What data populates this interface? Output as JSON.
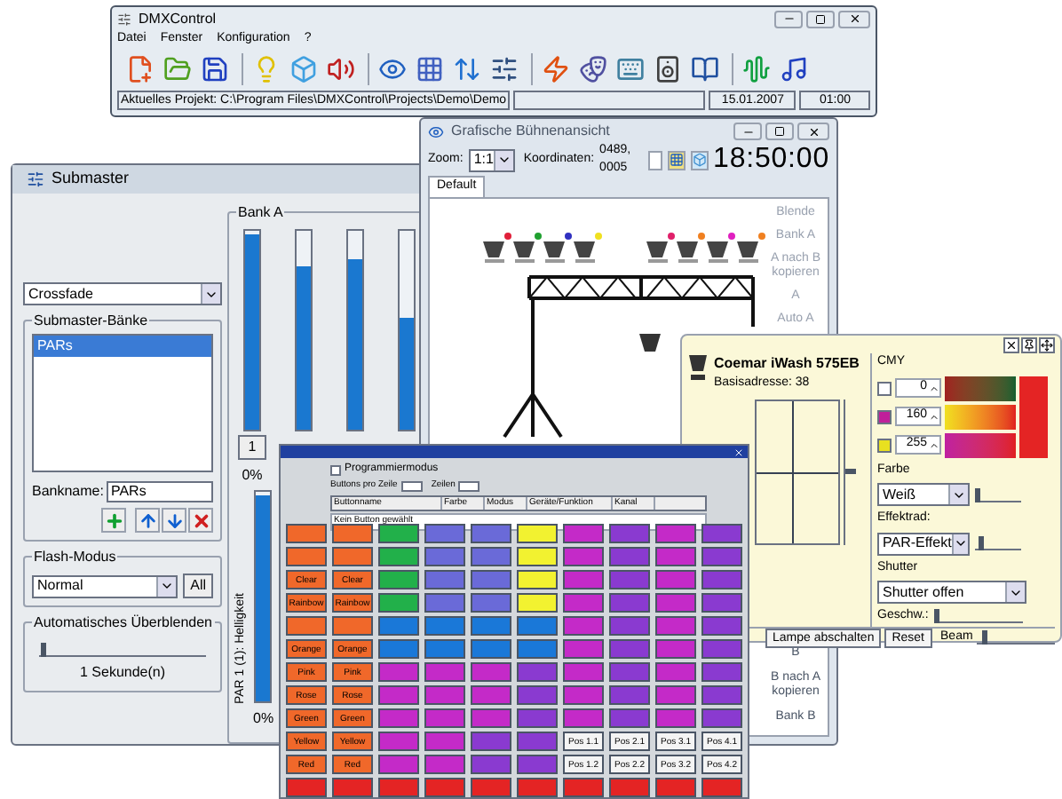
{
  "main_window": {
    "title": "DMXControl",
    "menu": [
      "Datei",
      "Fenster",
      "Konfiguration",
      "?"
    ],
    "status": {
      "project": "Aktuelles Projekt: C:\\Program Files\\DMXControl\\Projects\\Demo\\Demo",
      "date": "15.01.2007",
      "time": "01:00"
    }
  },
  "submaster": {
    "title": "Submaster",
    "mode": "Crossfade",
    "banks_label": "Submaster-Bänke",
    "banks": [
      {
        "label": "PARs",
        "selected": true
      }
    ],
    "bankname_label": "Bankname:",
    "bankname": "PARs",
    "flash_label": "Flash-Modus",
    "flash_mode": "Normal",
    "all_button": "All",
    "auto_label": "Automatisches Überblenden",
    "auto_slider": {
      "level": 0.02
    },
    "auto_reading": "1 Sekunde(n)",
    "bank_a_label": "Bank A",
    "faders": [
      {
        "level": 0.98
      },
      {
        "level": 0.82
      },
      {
        "level": 0.86
      },
      {
        "level": 0.56
      }
    ],
    "fader_button": "1",
    "fader_reading": "0%",
    "lower_fader": {
      "level": 0.98,
      "reading": "0%",
      "caption": "PAR 1 (1): Helligkeit"
    },
    "side_top": [
      "Blende",
      "Bank A",
      "A nach B kopieren",
      "A",
      "Auto A"
    ],
    "side_bottom": [
      "B",
      "B nach A kopieren",
      "Bank B"
    ]
  },
  "stage": {
    "title": "Grafische Bühnenansicht",
    "zoom_label": "Zoom:",
    "zoom": "1:1",
    "coords_label": "Koordinaten:",
    "coords": "0489, 0005",
    "clock": "18:50:00",
    "tabs": [
      {
        "label": "Default",
        "selected": true
      }
    ],
    "fixtures": [
      {
        "color": "#e0203a"
      },
      {
        "color": "#20a030"
      },
      {
        "color": "#3030c0"
      },
      {
        "color": "#f0e020"
      },
      {
        "color": "#e0206a"
      },
      {
        "color": "#f08020"
      },
      {
        "color": "#e020c0"
      },
      {
        "color": "#f08020"
      }
    ]
  },
  "device": {
    "name": "Coemar iWash 575EB",
    "address": "Basisadresse: 38",
    "pan_tilt": {
      "level": 0.5
    },
    "cmy_label": "CMY",
    "cmy": [
      {
        "value": "0",
        "color": "#ffffff"
      },
      {
        "value": "160",
        "color": "#c0209a"
      },
      {
        "value": "255",
        "color": "#e8e020"
      }
    ],
    "color_label": "Farbe",
    "color_value": "Weiß",
    "color_slider": {
      "level": 0.05
    },
    "effect_label": "Effektrad:",
    "effect_value": "PAR-Effekt",
    "effect_slider": {
      "level": 0.1
    },
    "shutter_label": "Shutter",
    "shutter_value": "Shutter offen",
    "speed_label": "Geschw.:",
    "speed_slider": {
      "level": 0.02
    },
    "actions": [
      "Lampe abschalten",
      "Reset"
    ],
    "beam_label": "Beam",
    "beam_slider": {
      "level": 0.1
    }
  },
  "buttons_window": {
    "program_mode": {
      "label": "Programmiermodus",
      "checked": false
    },
    "per_row_label": "Buttons pro Zeile",
    "rows_label": "Zeilen",
    "columns": [
      "Buttonname",
      "Farbe",
      "Modus",
      "Geräte/Funktion",
      "Kanal"
    ],
    "selection": "Kein Button gewählt",
    "grid": [
      [
        {
          "color": "#f0682a"
        },
        {
          "color": "#f0682a"
        },
        {
          "color": "#22b04a"
        },
        {
          "color": "#6a6ad8"
        },
        {
          "color": "#6a6ad8"
        },
        {
          "color": "#f2f230"
        },
        {
          "color": "#c42ac8"
        },
        {
          "color": "#8a3ad0"
        },
        {
          "color": "#c42ac8"
        },
        {
          "color": "#8a3ad0"
        }
      ],
      [
        {
          "color": "#f0682a"
        },
        {
          "color": "#f0682a"
        },
        {
          "color": "#22b04a"
        },
        {
          "color": "#6a6ad8"
        },
        {
          "color": "#6a6ad8"
        },
        {
          "color": "#f2f230"
        },
        {
          "color": "#c42ac8"
        },
        {
          "color": "#8a3ad0"
        },
        {
          "color": "#c42ac8"
        },
        {
          "color": "#8a3ad0"
        }
      ],
      [
        {
          "color": "#f0682a",
          "label": "Clear"
        },
        {
          "color": "#f0682a",
          "label": "Clear"
        },
        {
          "color": "#22b04a"
        },
        {
          "color": "#6a6ad8"
        },
        {
          "color": "#6a6ad8"
        },
        {
          "color": "#f2f230"
        },
        {
          "color": "#c42ac8"
        },
        {
          "color": "#8a3ad0"
        },
        {
          "color": "#c42ac8"
        },
        {
          "color": "#8a3ad0"
        }
      ],
      [
        {
          "color": "#f0682a",
          "label": "Rainbow"
        },
        {
          "color": "#f0682a",
          "label": "Rainbow"
        },
        {
          "color": "#22b04a"
        },
        {
          "color": "#6a6ad8"
        },
        {
          "color": "#6a6ad8"
        },
        {
          "color": "#f2f230"
        },
        {
          "color": "#c42ac8"
        },
        {
          "color": "#8a3ad0"
        },
        {
          "color": "#c42ac8"
        },
        {
          "color": "#8a3ad0"
        }
      ],
      [
        {
          "color": "#f0682a"
        },
        {
          "color": "#f0682a"
        },
        {
          "color": "#1a78d8"
        },
        {
          "color": "#1a78d8"
        },
        {
          "color": "#1a78d8"
        },
        {
          "color": "#1a78d8"
        },
        {
          "color": "#c42ac8"
        },
        {
          "color": "#8a3ad0"
        },
        {
          "color": "#c42ac8"
        },
        {
          "color": "#8a3ad0"
        }
      ],
      [
        {
          "color": "#f0682a",
          "label": "Orange"
        },
        {
          "color": "#f0682a",
          "label": "Orange"
        },
        {
          "color": "#1a78d8"
        },
        {
          "color": "#1a78d8"
        },
        {
          "color": "#1a78d8"
        },
        {
          "color": "#1a78d8"
        },
        {
          "color": "#c42ac8"
        },
        {
          "color": "#8a3ad0"
        },
        {
          "color": "#c42ac8"
        },
        {
          "color": "#8a3ad0"
        }
      ],
      [
        {
          "color": "#f0682a",
          "label": "Pink"
        },
        {
          "color": "#f0682a",
          "label": "Pink"
        },
        {
          "color": "#c42ac8"
        },
        {
          "color": "#c42ac8"
        },
        {
          "color": "#c42ac8"
        },
        {
          "color": "#8a3ad0"
        },
        {
          "color": "#c42ac8"
        },
        {
          "color": "#8a3ad0"
        },
        {
          "color": "#c42ac8"
        },
        {
          "color": "#8a3ad0"
        }
      ],
      [
        {
          "color": "#f0682a",
          "label": "Rose"
        },
        {
          "color": "#f0682a",
          "label": "Rose"
        },
        {
          "color": "#c42ac8"
        },
        {
          "color": "#c42ac8"
        },
        {
          "color": "#c42ac8"
        },
        {
          "color": "#8a3ad0"
        },
        {
          "color": "#c42ac8"
        },
        {
          "color": "#8a3ad0"
        },
        {
          "color": "#c42ac8"
        },
        {
          "color": "#8a3ad0"
        }
      ],
      [
        {
          "color": "#f0682a",
          "label": "Green"
        },
        {
          "color": "#f0682a",
          "label": "Green"
        },
        {
          "color": "#c42ac8"
        },
        {
          "color": "#c42ac8"
        },
        {
          "color": "#c42ac8"
        },
        {
          "color": "#8a3ad0"
        },
        {
          "color": "#c42ac8"
        },
        {
          "color": "#8a3ad0"
        },
        {
          "color": "#c42ac8"
        },
        {
          "color": "#8a3ad0"
        }
      ],
      [
        {
          "color": "#f0682a",
          "label": "Yellow"
        },
        {
          "color": "#f0682a",
          "label": "Yellow"
        },
        {
          "color": "#c42ac8"
        },
        {
          "color": "#c42ac8"
        },
        {
          "color": "#8a3ad0"
        },
        {
          "color": "#8a3ad0"
        },
        {
          "color": "#f4f4f4",
          "label": "Pos 1.1"
        },
        {
          "color": "#f4f4f4",
          "label": "Pos 2.1"
        },
        {
          "color": "#f4f4f4",
          "label": "Pos 3.1"
        },
        {
          "color": "#f4f4f4",
          "label": "Pos 4.1"
        }
      ],
      [
        {
          "color": "#f0682a",
          "label": "Red"
        },
        {
          "color": "#f0682a",
          "label": "Red"
        },
        {
          "color": "#c42ac8"
        },
        {
          "color": "#c42ac8"
        },
        {
          "color": "#8a3ad0"
        },
        {
          "color": "#8a3ad0"
        },
        {
          "color": "#f4f4f4",
          "label": "Pos 1.2"
        },
        {
          "color": "#f4f4f4",
          "label": "Pos 2.2"
        },
        {
          "color": "#f4f4f4",
          "label": "Pos 3.2"
        },
        {
          "color": "#f4f4f4",
          "label": "Pos 4.2"
        }
      ],
      [
        {
          "color": "#e42424"
        },
        {
          "color": "#e42424"
        },
        {
          "color": "#e42424"
        },
        {
          "color": "#e42424"
        },
        {
          "color": "#e42424"
        },
        {
          "color": "#e42424"
        },
        {
          "color": "#e42424"
        },
        {
          "color": "#e42424"
        },
        {
          "color": "#e42424"
        },
        {
          "color": "#e42424"
        }
      ]
    ]
  }
}
